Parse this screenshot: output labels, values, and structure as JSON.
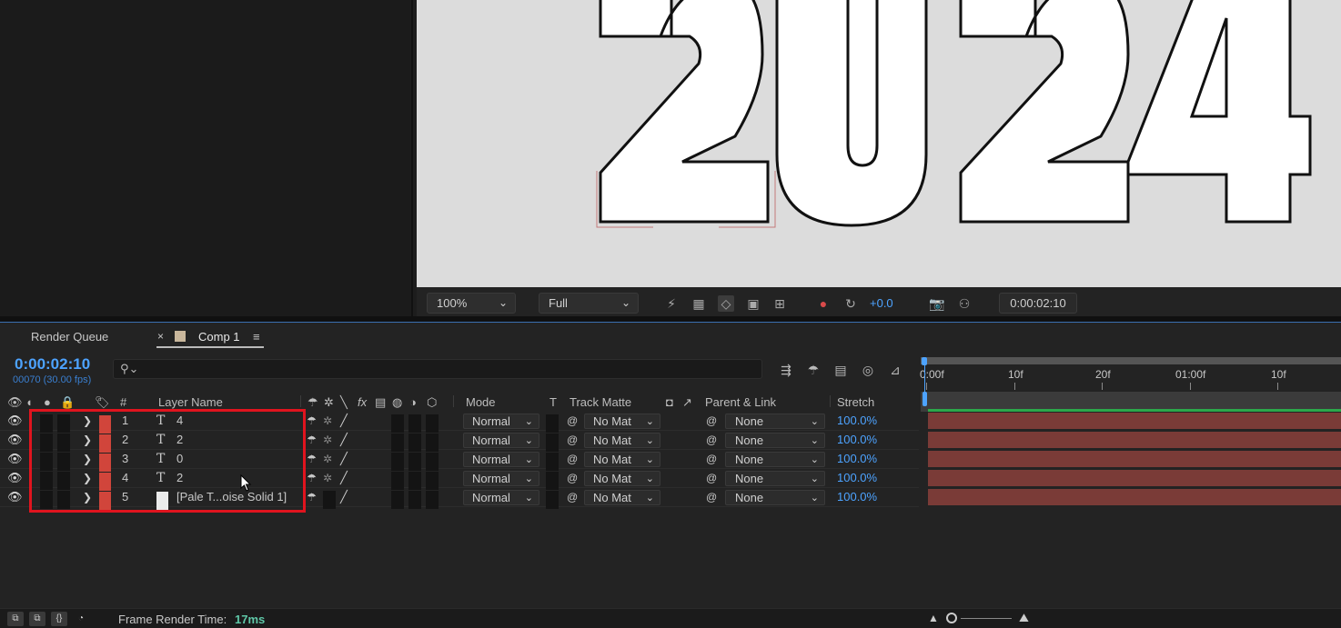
{
  "viewer": {
    "zoom": "100%",
    "resolution": "Full",
    "exposure": "+0.0",
    "timecode": "0:00:02:10",
    "preview_text": "2024"
  },
  "timeline": {
    "tabs": {
      "render_queue": "Render Queue",
      "comp_close": "×",
      "comp": "Comp 1",
      "menu": "≡"
    },
    "timecode": "0:00:02:10",
    "frames": "00070 (30.00 fps)",
    "search_icon": "search-icon",
    "headers": {
      "num": "#",
      "layer_name": "Layer Name",
      "fx": "fx",
      "mode": "Mode",
      "t": "T",
      "track_matte": "Track Matte",
      "parent": "Parent & Link",
      "stretch": "Stretch"
    },
    "ruler": [
      "0:00f",
      "10f",
      "20f",
      "01:00f",
      "10f"
    ],
    "layers": [
      {
        "num": "1",
        "type": "T",
        "name": "4",
        "mode": "Normal",
        "matte": "No Mat",
        "parent": "None",
        "stretch": "100.0%"
      },
      {
        "num": "2",
        "type": "T",
        "name": "2",
        "mode": "Normal",
        "matte": "No Mat",
        "parent": "None",
        "stretch": "100.0%"
      },
      {
        "num": "3",
        "type": "T",
        "name": "0",
        "mode": "Normal",
        "matte": "No Mat",
        "parent": "None",
        "stretch": "100.0%"
      },
      {
        "num": "4",
        "type": "T",
        "name": "2",
        "mode": "Normal",
        "matte": "No Mat",
        "parent": "None",
        "stretch": "100.0%"
      },
      {
        "num": "5",
        "type": "solid",
        "name": "[Pale T...oise Solid 1]",
        "mode": "Normal",
        "matte": "No Mat",
        "parent": "None",
        "stretch": "100.0%"
      }
    ],
    "footer": {
      "frame_render_label": "Frame Render Time:",
      "frame_render_value": "17ms"
    }
  },
  "colors": {
    "accent": "#4da3ff",
    "label_red": "#d1453b",
    "layer_bar": "#7a3b37",
    "highlight": "#e0141e"
  }
}
